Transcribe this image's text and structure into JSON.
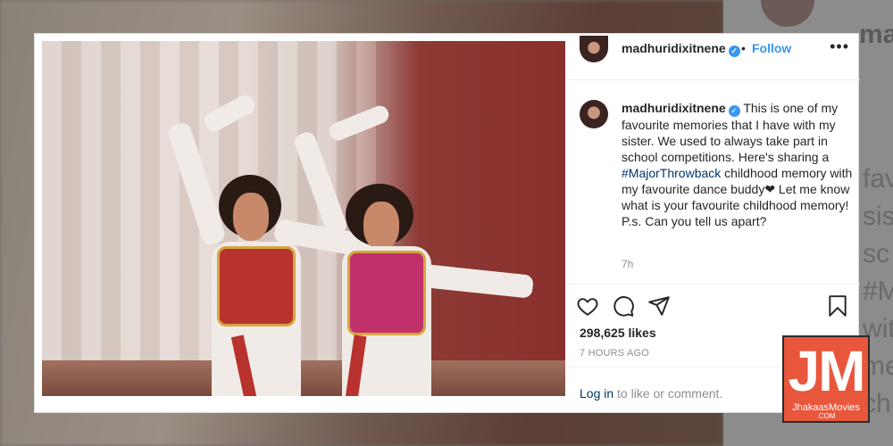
{
  "post": {
    "username": "madhuridixitnene",
    "follow_label": "Follow",
    "separator": "•",
    "more_label": "•••",
    "caption_part1": "This is one of my favourite memories that I have with my sister. We used to always take part in school competitions. Here's sharing a ",
    "hashtag": "#MajorThrowback",
    "caption_part2": " childhood memory with my favourite dance buddy❤ Let me know what is your favourite childhood memory!",
    "caption_ps": "P.s. Can you tell us apart?",
    "comment_time": "7h",
    "likes": "298,625 likes",
    "posted_ago": "7 HOURS AGO",
    "login_link": "Log in",
    "login_rest": " to like or comment."
  },
  "background": {
    "username_partial": "ma",
    "text_fragments": "fav\nsis\nsc\n#M\nwit\nme\nch"
  },
  "watermark": {
    "letters": "JM",
    "brand": "JhakaasMovies",
    "suffix": ".COM"
  },
  "colors": {
    "link_blue": "#3897f0",
    "hashtag_blue": "#003569",
    "text": "#262626",
    "muted": "#8e8e8e",
    "watermark_bg": "#e8573c"
  },
  "icons": [
    "heart-icon",
    "comment-icon",
    "share-icon",
    "bookmark-icon",
    "verified-icon",
    "more-icon"
  ]
}
